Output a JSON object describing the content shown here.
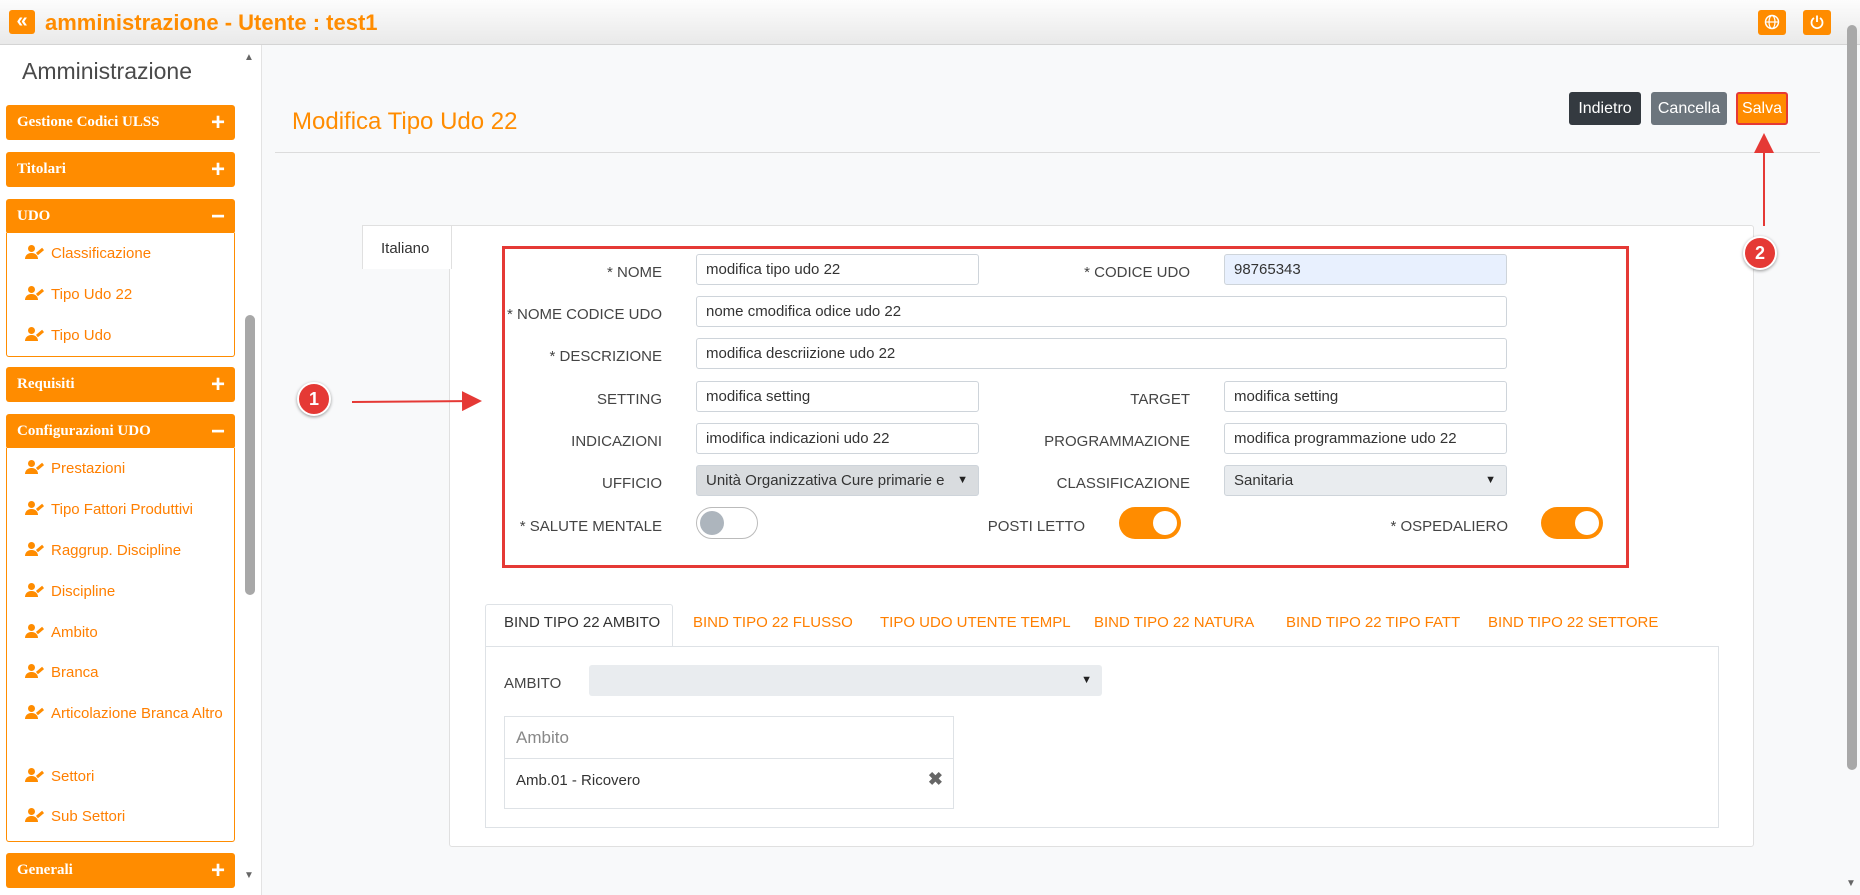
{
  "topbar": {
    "back_icon": "double-chevron-left",
    "title": "amministrazione - Utente : test1",
    "globe_icon": "globe-icon",
    "power_icon": "power-icon"
  },
  "sidebar": {
    "title": "Amministrazione",
    "groups": [
      {
        "label": "Gestione Codici ULSS",
        "sign": "+"
      },
      {
        "label": "Titolari",
        "sign": "+"
      },
      {
        "label": "UDO",
        "sign": "−",
        "items": [
          "Classificazione",
          "Tipo Udo 22",
          "Tipo Udo"
        ]
      },
      {
        "label": "Requisiti",
        "sign": "+"
      },
      {
        "label": "Configurazioni UDO",
        "sign": "−",
        "items": [
          "Prestazioni",
          "Tipo Fattori Produttivi",
          "Raggrup. Discipline",
          "Discipline",
          "Ambito",
          "Branca",
          "Articolazione Branca Altro",
          "Settori",
          "Sub Settori"
        ]
      },
      {
        "label": "Generali",
        "sign": "+"
      }
    ]
  },
  "header": {
    "page_title": "Modifica Tipo Udo 22",
    "back_button": "Indietro",
    "cancel_button": "Cancella",
    "save_button": "Salva"
  },
  "form": {
    "lang_tab": "Italiano",
    "nome_label": "* NOME",
    "nome_value": "modifica tipo udo 22",
    "codice_udo_label": "* CODICE UDO",
    "codice_udo_value": "98765343",
    "nome_codice_label": "* NOME CODICE UDO",
    "nome_codice_value": "nome cmodifica odice udo 22",
    "descrizione_label": "* DESCRIZIONE",
    "descrizione_value": "modifica descriizione udo 22",
    "setting_label": "SETTING",
    "setting_value": "modifica setting",
    "target_label": "TARGET",
    "target_value": "modifica setting",
    "indicazioni_label": "INDICAZIONI",
    "indicazioni_value": "imodifica indicazioni udo 22",
    "programmazione_label": "PROGRAMMAZIONE",
    "programmazione_value": "modifica programmazione udo 22",
    "ufficio_label": "UFFICIO",
    "ufficio_value": "Unità Organizzativa Cure primarie e",
    "classificazione_label": "CLASSIFICAZIONE",
    "classificazione_value": "Sanitaria",
    "salute_label": "* SALUTE MENTALE",
    "salute_on": false,
    "posti_label": "POSTI LETTO",
    "posti_on": true,
    "ospedaliero_label": "* OSPEDALIERO",
    "ospedaliero_on": true
  },
  "subtabs": [
    "BIND TIPO 22 AMBITO",
    "BIND TIPO 22 FLUSSO",
    "TIPO UDO UTENTE TEMPL",
    "BIND TIPO 22 NATURA",
    "BIND TIPO 22 TIPO FATT",
    "BIND TIPO 22 SETTORE"
  ],
  "ambito": {
    "label": "AMBITO",
    "select_value": "",
    "table_header": "Ambito",
    "rows": [
      "Amb.01 - Ricovero"
    ]
  },
  "annotations": [
    "1",
    "2"
  ],
  "colors": {
    "accent": "#ff8c00",
    "highlight": "#e53935"
  }
}
